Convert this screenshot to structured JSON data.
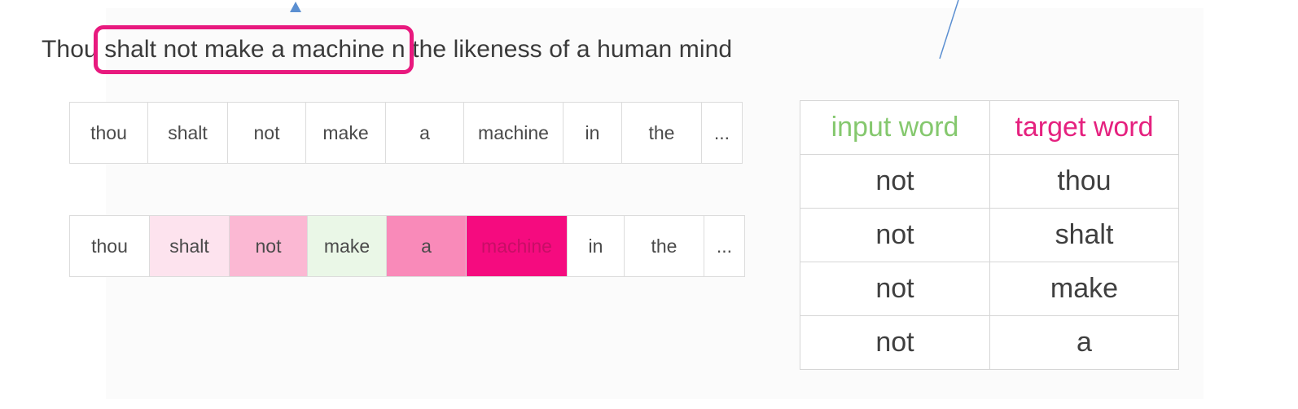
{
  "sentence": {
    "lead": "Thou",
    "highlighted": "shalt not make a machine",
    "rest": "n the likeness of a human mind"
  },
  "colors": {
    "highlight_border": "#e8197e",
    "input_header": "#85c86e",
    "target_header": "#e5217f",
    "arrow": "#5b8fd1"
  },
  "tokens_row_plain": [
    "thou",
    "shalt",
    "not",
    "make",
    "a",
    "machine",
    "in",
    "the",
    "..."
  ],
  "tokens_row_window": [
    {
      "word": "thou",
      "bg": "#ffffff",
      "fg": "#4a4a4a"
    },
    {
      "word": "shalt",
      "bg": "#fde3ee",
      "fg": "#4a4a4a"
    },
    {
      "word": "not",
      "bg": "#fbb8d3",
      "fg": "#4a4a4a"
    },
    {
      "word": "make",
      "bg": "#eaf7e7",
      "fg": "#4a4a4a"
    },
    {
      "word": "a",
      "bg": "#f98ab9",
      "fg": "#4a4a4a"
    },
    {
      "word": "machine",
      "bg": "#f50b7f",
      "fg": "#c70e66"
    },
    {
      "word": "in",
      "bg": "#ffffff",
      "fg": "#4a4a4a"
    },
    {
      "word": "the",
      "bg": "#ffffff",
      "fg": "#4a4a4a"
    },
    {
      "word": "...",
      "bg": "#ffffff",
      "fg": "#4a4a4a"
    }
  ],
  "table": {
    "headers": {
      "input": "input word",
      "target": "target word"
    },
    "rows": [
      {
        "input": "not",
        "target": "thou"
      },
      {
        "input": "not",
        "target": "shalt"
      },
      {
        "input": "not",
        "target": "make"
      },
      {
        "input": "not",
        "target": "a"
      }
    ]
  }
}
